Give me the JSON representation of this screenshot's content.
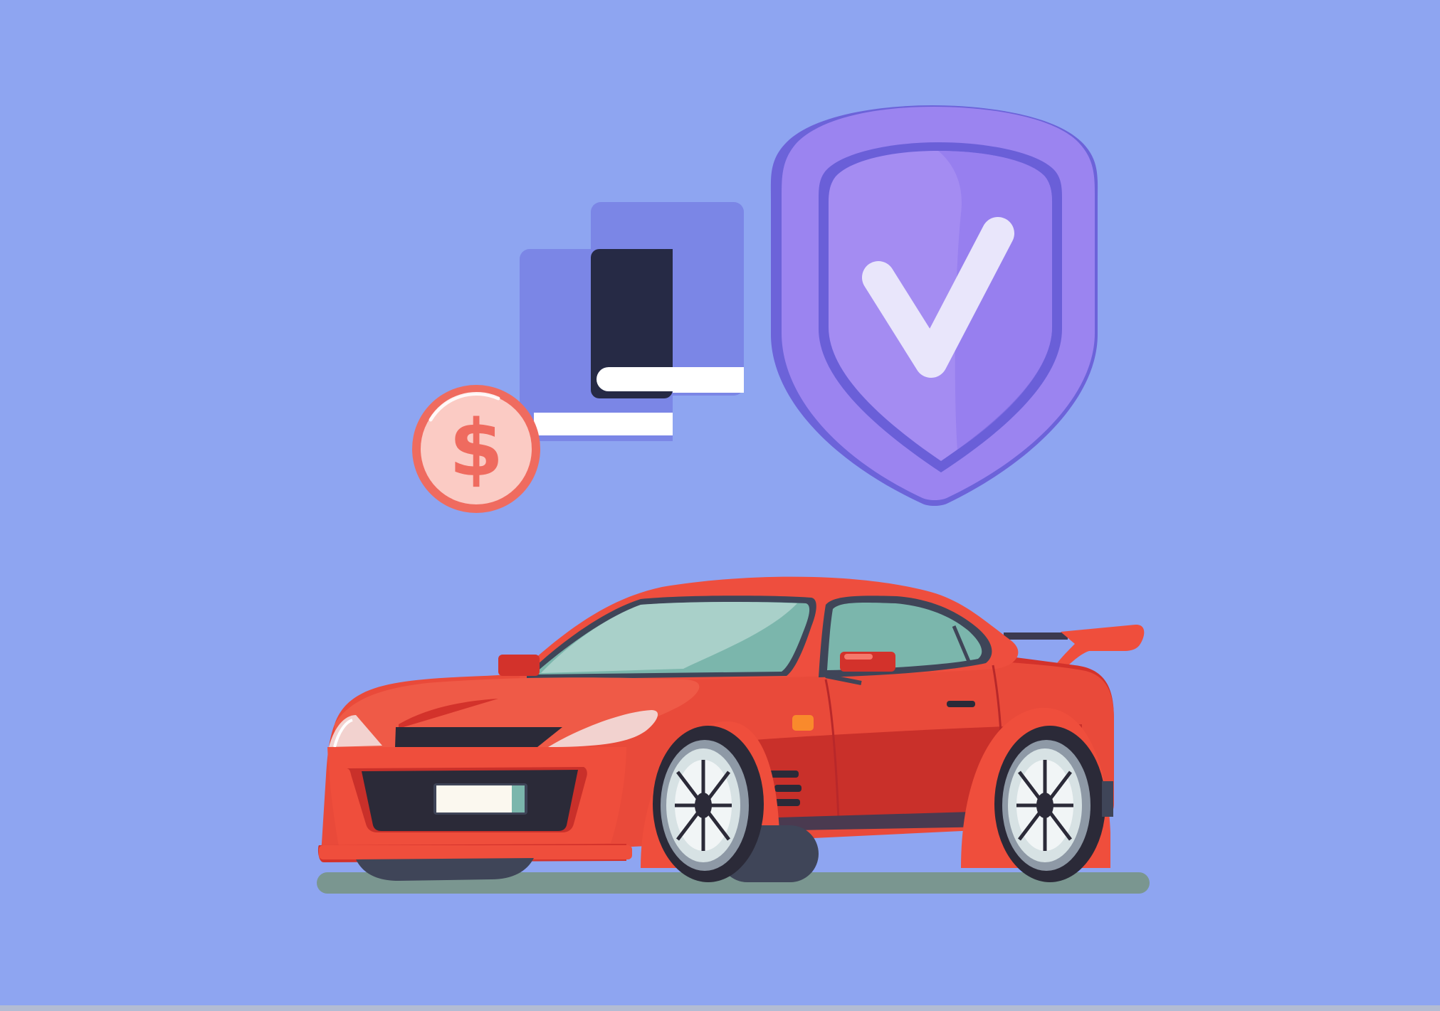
{
  "scene": {
    "description_label": "",
    "coin_symbol": "$",
    "colors": {
      "background": "#8ea5f1",
      "car_body": "#e9463a",
      "car_body_dark": "#c9302a",
      "glass": "#7bb6ac",
      "shield": "#9b84f0",
      "shield_dark": "#6c63d9",
      "book": "#7b86e6",
      "book_cover": "#262a45",
      "coin": "#f0776c",
      "coin_inner": "#fbcbc4",
      "shadow": "#7a9690"
    },
    "icons": [
      "book-icon",
      "coin-dollar-icon",
      "shield-check-icon",
      "sports-car-illustration"
    ]
  }
}
